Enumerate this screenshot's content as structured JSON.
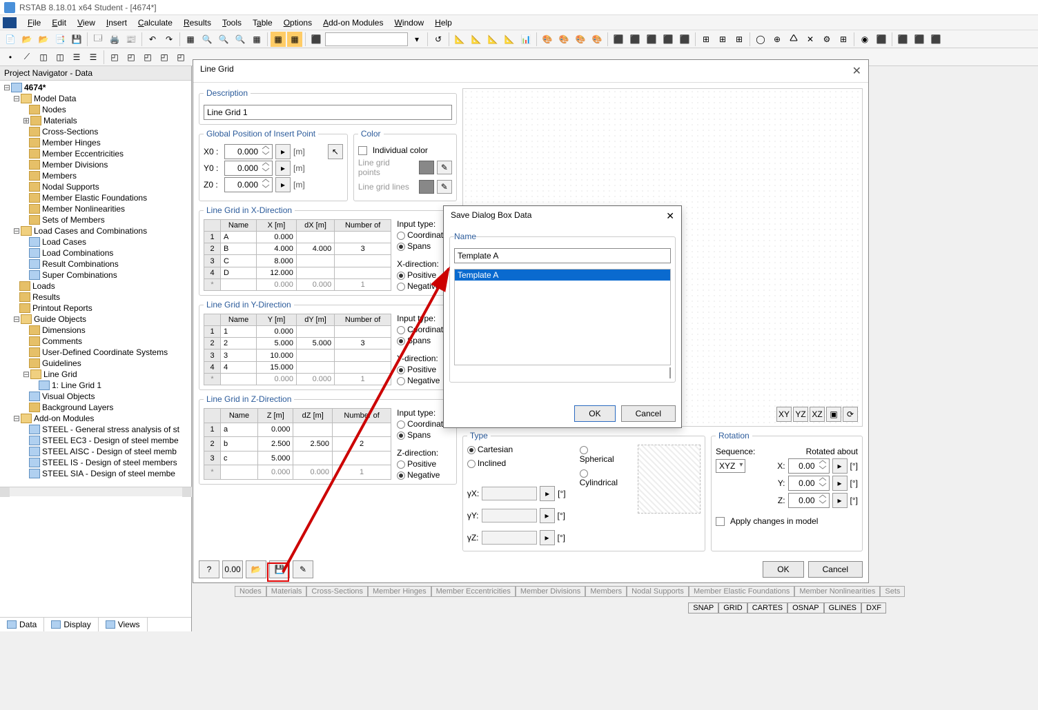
{
  "app_title": "RSTAB 8.18.01 x64 Student - [4674*]",
  "menus": [
    "File",
    "Edit",
    "View",
    "Insert",
    "Calculate",
    "Results",
    "Tools",
    "Table",
    "Options",
    "Add-on Modules",
    "Window",
    "Help"
  ],
  "navigator": {
    "title": "Project Navigator - Data",
    "root": "4674*",
    "tree": {
      "model_data": "Model Data",
      "nodes": "Nodes",
      "materials": "Materials",
      "cross_sections": "Cross-Sections",
      "member_hinges": "Member Hinges",
      "member_eccent": "Member Eccentricities",
      "member_div": "Member Divisions",
      "members": "Members",
      "nodal_supports": "Nodal Supports",
      "member_ef": "Member Elastic Foundations",
      "member_nonlin": "Member Nonlinearities",
      "sets_members": "Sets of Members",
      "lc_combos": "Load Cases and Combinations",
      "load_cases": "Load Cases",
      "load_combos": "Load Combinations",
      "result_combos": "Result Combinations",
      "super_combos": "Super Combinations",
      "loads": "Loads",
      "results": "Results",
      "printout": "Printout Reports",
      "guide_objects": "Guide Objects",
      "dimensions": "Dimensions",
      "comments": "Comments",
      "udcs": "User-Defined Coordinate Systems",
      "guidelines": "Guidelines",
      "line_grid": "Line Grid",
      "line_grid_1": "1: Line Grid 1",
      "visual_objects": "Visual Objects",
      "bg_layers": "Background Layers",
      "addon_modules": "Add-on Modules",
      "steel": "STEEL - General stress analysis of st",
      "steel_ec3": "STEEL EC3 - Design of steel membe",
      "steel_aisc": "STEEL AISC - Design of steel memb",
      "steel_is": "STEEL IS - Design of steel members",
      "steel_sia": "STEEL SIA - Design of steel membe"
    },
    "tabs": {
      "data": "Data",
      "display": "Display",
      "views": "Views"
    }
  },
  "line_grid": {
    "title": "Line Grid",
    "description_lbl": "Description",
    "description": "Line Grid 1",
    "global_pos_lbl": "Global Position of Insert Point",
    "x0_lbl": "X0 :",
    "x0": "0.000",
    "y0_lbl": "Y0 :",
    "y0": "0.000",
    "z0_lbl": "Z0 :",
    "z0": "0.000",
    "unit_m": "[m]",
    "color_lbl": "Color",
    "indiv_color": "Individual color",
    "lg_points": "Line grid points",
    "lg_lines": "Line grid lines",
    "x_dir_lbl": "Line Grid in X-Direction",
    "y_dir_lbl": "Line Grid in Y-Direction",
    "z_dir_lbl": "Line Grid in Z-Direction",
    "col_name": "Name",
    "col_x": "X [m]",
    "col_dx": "dX [m]",
    "col_y": "Y [m]",
    "col_dy": "dY [m]",
    "col_z": "Z [m]",
    "col_dz": "dZ [m]",
    "col_numof": "Number of",
    "x_rows": [
      {
        "n": "1",
        "name": "A",
        "v": "0.000",
        "d": "",
        "num": ""
      },
      {
        "n": "2",
        "name": "B",
        "v": "4.000",
        "d": "4.000",
        "num": "3"
      },
      {
        "n": "3",
        "name": "C",
        "v": "8.000",
        "d": "",
        "num": ""
      },
      {
        "n": "4",
        "name": "D",
        "v": "12.000",
        "d": "",
        "num": ""
      },
      {
        "n": "*",
        "name": "",
        "v": "0.000",
        "d": "0.000",
        "num": "1"
      }
    ],
    "y_rows": [
      {
        "n": "1",
        "name": "1",
        "v": "0.000",
        "d": "",
        "num": ""
      },
      {
        "n": "2",
        "name": "2",
        "v": "5.000",
        "d": "5.000",
        "num": "3"
      },
      {
        "n": "3",
        "name": "3",
        "v": "10.000",
        "d": "",
        "num": ""
      },
      {
        "n": "4",
        "name": "4",
        "v": "15.000",
        "d": "",
        "num": ""
      },
      {
        "n": "*",
        "name": "",
        "v": "0.000",
        "d": "0.000",
        "num": "1"
      }
    ],
    "z_rows": [
      {
        "n": "1",
        "name": "a",
        "v": "0.000",
        "d": "",
        "num": ""
      },
      {
        "n": "2",
        "name": "b",
        "v": "2.500",
        "d": "2.500",
        "num": "2"
      },
      {
        "n": "3",
        "name": "c",
        "v": "5.000",
        "d": "",
        "num": ""
      },
      {
        "n": "*",
        "name": "",
        "v": "0.000",
        "d": "0.000",
        "num": "1"
      }
    ],
    "input_type_lbl": "Input type:",
    "coordinates_opt": "Coordinates",
    "spans_opt": "Spans",
    "x_dir_opt_lbl": "X-direction:",
    "y_dir_opt_lbl": "Y-direction:",
    "z_dir_opt_lbl": "Z-direction:",
    "positive_opt": "Positive",
    "negative_opt": "Negative",
    "type_lbl": "Type",
    "cartesian": "Cartesian",
    "spherical": "Spherical",
    "inclined": "Inclined",
    "cylindrical": "Cylindrical",
    "gyx": "γX:",
    "gyy": "γY:",
    "gyz": "γZ:",
    "deg": "[°]",
    "rotation_lbl": "Rotation",
    "sequence_lbl": "Sequence:",
    "rotated_about": "Rotated about",
    "seq_val": "XYZ",
    "rx": "X:",
    "ry": "Y:",
    "rz": "Z:",
    "rval": "0.00",
    "apply_changes": "Apply changes in model",
    "ok": "OK",
    "cancel": "Cancel"
  },
  "save_dialog": {
    "title": "Save Dialog Box Data",
    "name_lbl": "Name",
    "name": "Template A",
    "list_item": "Template A",
    "ok": "OK",
    "cancel": "Cancel"
  },
  "model_tabs": [
    "Nodes",
    "Materials",
    "Cross-Sections",
    "Member Hinges",
    "Member Eccentricities",
    "Member Divisions",
    "Members",
    "Nodal Supports",
    "Member Elastic Foundations",
    "Member Nonlinearities",
    "Sets"
  ],
  "status": [
    "SNAP",
    "GRID",
    "CARTES",
    "OSNAP",
    "GLINES",
    "DXF"
  ]
}
